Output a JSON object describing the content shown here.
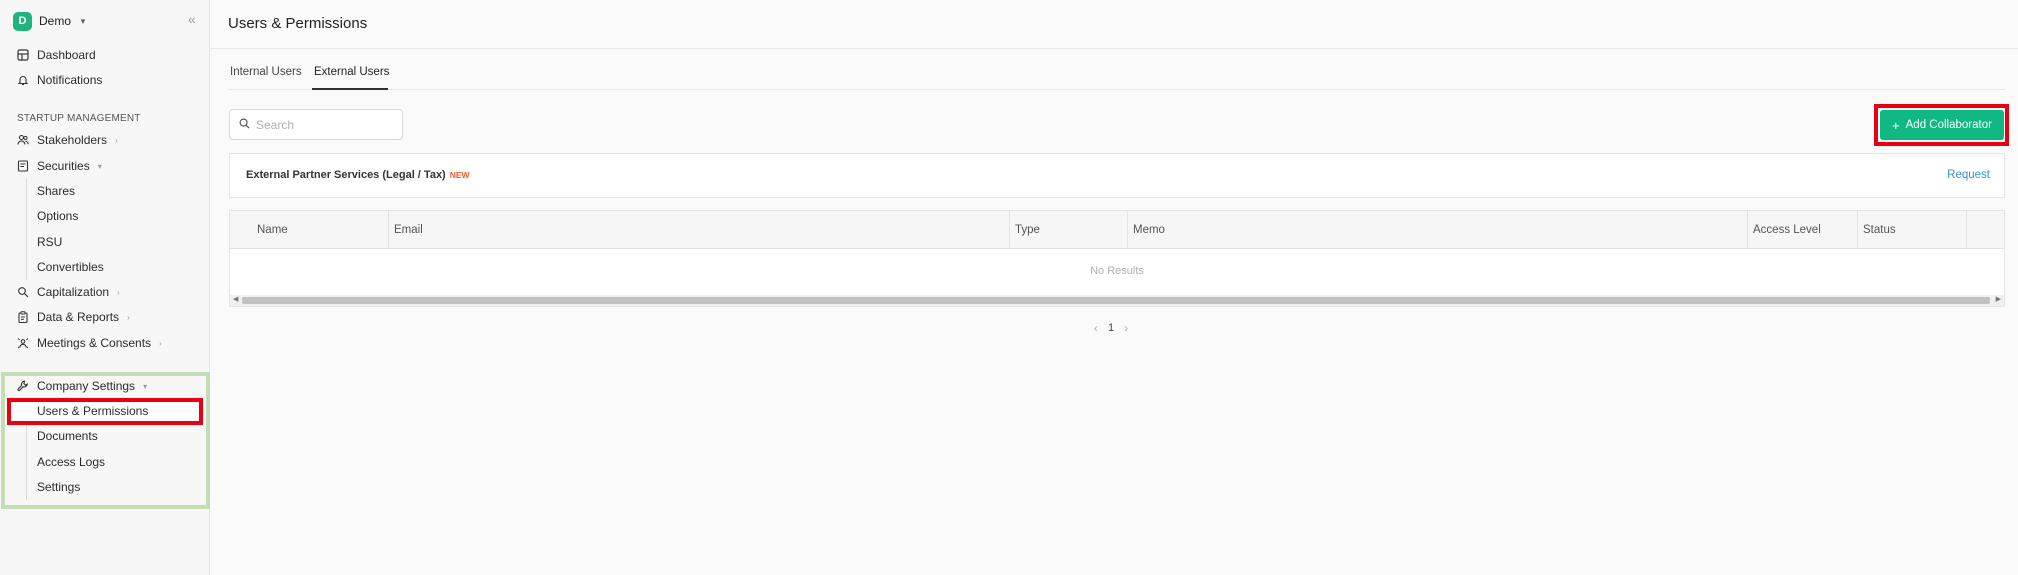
{
  "workspace": {
    "initial": "D",
    "name": "Demo"
  },
  "sidebar": {
    "top_items": [
      {
        "label": "Dashboard"
      },
      {
        "label": "Notifications"
      }
    ],
    "section_label": "STARTUP MANAGEMENT",
    "items": [
      {
        "label": "Stakeholders"
      },
      {
        "label": "Securities"
      },
      {
        "label": "Capitalization"
      },
      {
        "label": "Data & Reports"
      },
      {
        "label": "Meetings & Consents"
      },
      {
        "label": "Company Settings"
      }
    ],
    "securities_sub": [
      "Shares",
      "Options",
      "RSU",
      "Convertibles"
    ],
    "settings_sub": [
      "Users & Permissions",
      "Documents",
      "Access Logs",
      "Settings"
    ]
  },
  "page": {
    "title": "Users & Permissions"
  },
  "tabs": [
    {
      "label": "Internal Users",
      "active": false
    },
    {
      "label": "External Users",
      "active": true
    }
  ],
  "search": {
    "placeholder": "Search"
  },
  "add_button": {
    "label": "Add Collaborator"
  },
  "partner": {
    "title": "External Partner Services (Legal / Tax)",
    "badge": "NEW",
    "link": "Request"
  },
  "table": {
    "columns": [
      "Name",
      "Email",
      "Type",
      "Memo",
      "Access Level",
      "Status"
    ],
    "empty_text": "No Results"
  },
  "pagination": {
    "current": "1"
  },
  "colors": {
    "accent": "#10b981",
    "brand": "#21b47a",
    "link": "#3a8fd6",
    "badge": "#e85d2a",
    "highlight_red": "#e60012",
    "highlight_green": "#c3deb4"
  }
}
